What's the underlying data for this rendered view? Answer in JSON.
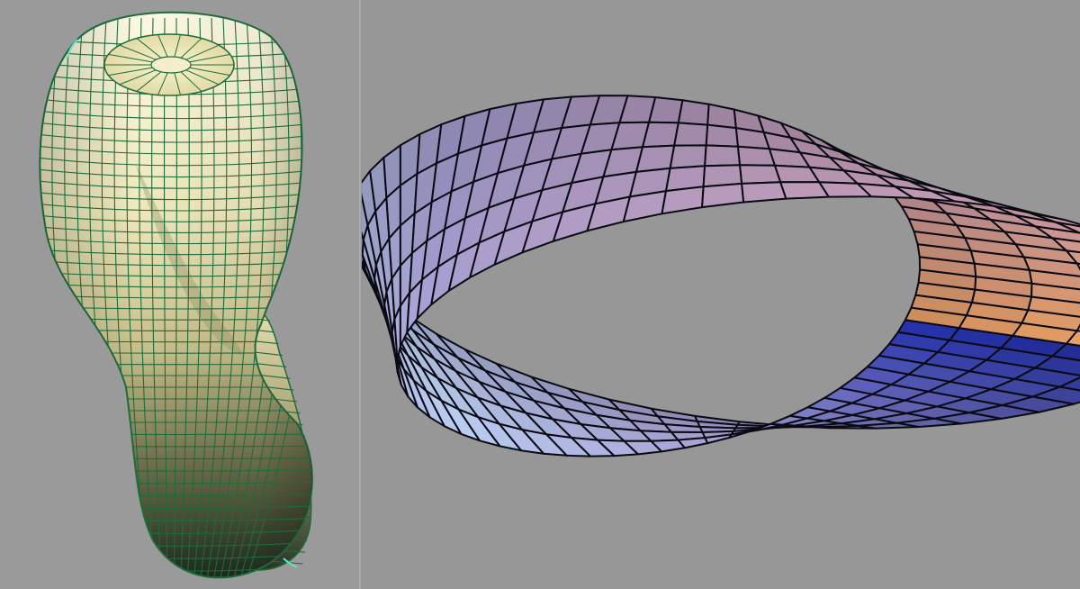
{
  "figures": {
    "left": {
      "icon": "klein-bottle-icon",
      "colors": {
        "light": "#fbf7d8",
        "mid": "#d5cfa0",
        "dark": "#1f2d1f",
        "grid": "#1e6b3c",
        "edge_glow": "#5fe0c8"
      }
    },
    "right": {
      "icon": "mobius-strip-icon",
      "colors": {
        "orange": "#f6a96e",
        "pink": "#c99aae",
        "lavender": "#a9a2d6",
        "light_blue": "#bcd2f4",
        "deep_blue": "#1c2aa8",
        "grid": "#0a0a14"
      }
    }
  }
}
